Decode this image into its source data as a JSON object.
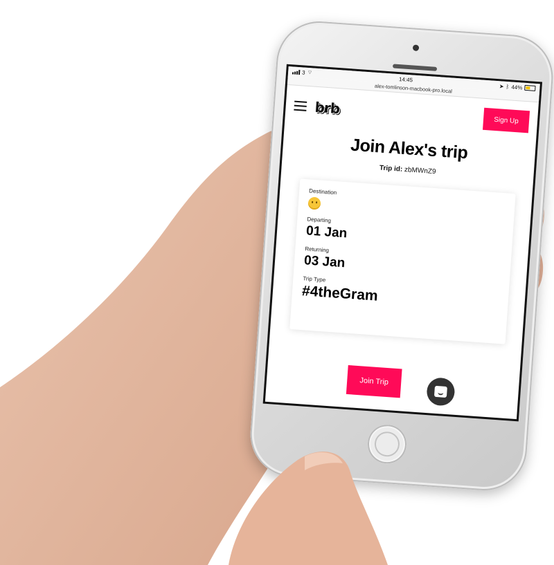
{
  "status_bar": {
    "carrier": "3",
    "time": "14:45",
    "battery": "44%",
    "battery_level": 0.44
  },
  "url_bar": {
    "url": "alex-tomlinson-macbook-pro.local"
  },
  "header": {
    "logo": "brb",
    "signup_label": "Sign Up"
  },
  "main": {
    "title": "Join Alex's trip",
    "trip_id_label": "Trip id:",
    "trip_id_value": "zbMWnZ9",
    "card": {
      "destination_label": "Destination",
      "destination_icon": "shushing-face-emoji",
      "departing_label": "Departing",
      "departing_value": "01 Jan",
      "returning_label": "Returning",
      "returning_value": "03 Jan",
      "trip_type_label": "Trip Type",
      "trip_type_value": "#4theGram"
    },
    "join_label": "Join Trip",
    "chat_icon": "chat-icon"
  },
  "colors": {
    "accent": "#ff0a58",
    "chat_button": "#333333",
    "text": "#000000"
  }
}
